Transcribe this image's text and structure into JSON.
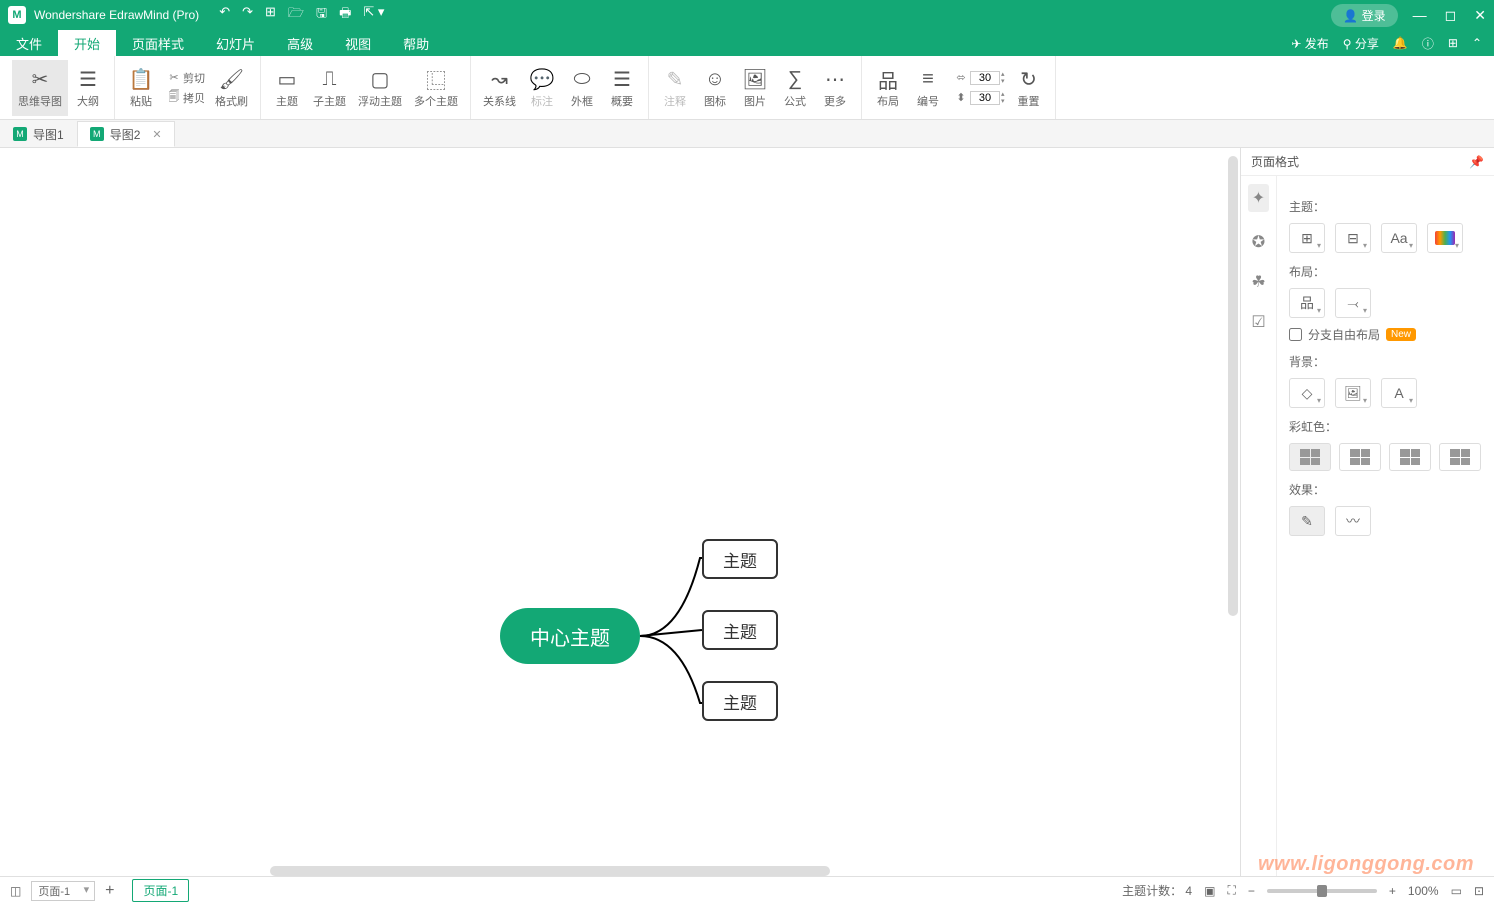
{
  "app": {
    "title": "Wondershare EdrawMind (Pro)",
    "login": "登录"
  },
  "menus": [
    "文件",
    "开始",
    "页面样式",
    "幻灯片",
    "高级",
    "视图",
    "帮助"
  ],
  "menu_active_index": 1,
  "menu_right": {
    "publish": "发布",
    "share": "分享"
  },
  "ribbon": {
    "mindmap": "思维导图",
    "outline": "大纲",
    "paste": "粘贴",
    "cut": "剪切",
    "copy": "拷贝",
    "formatpaint": "格式刷",
    "topic": "主题",
    "subtopic": "子主题",
    "floating": "浮动主题",
    "multiple": "多个主题",
    "relation": "关系线",
    "callout": "标注",
    "boundary": "外框",
    "summary": "概要",
    "note": "注释",
    "tag": "图标",
    "image": "图片",
    "formula": "公式",
    "more": "更多",
    "layout": "布局",
    "number": "编号",
    "width_val": "30",
    "height_val": "30",
    "reset": "重置"
  },
  "tabs": [
    {
      "label": "导图1",
      "active": false
    },
    {
      "label": "导图2",
      "active": true
    }
  ],
  "mindmap": {
    "center": "中心主题",
    "topics": [
      "主题",
      "主题",
      "主题"
    ]
  },
  "panel": {
    "title": "页面格式",
    "theme_label": "主题：",
    "layout_label": "布局：",
    "branch_free": "分支自由布局",
    "new_badge": "New",
    "background_label": "背景：",
    "rainbow_label": "彩虹色：",
    "effect_label": "效果："
  },
  "status": {
    "page_selector": "页面-1",
    "page_tab": "页面-1",
    "topic_count_label": "主题计数：",
    "topic_count": "4",
    "zoom": "100%"
  },
  "watermark": "www.ligonggong.com"
}
